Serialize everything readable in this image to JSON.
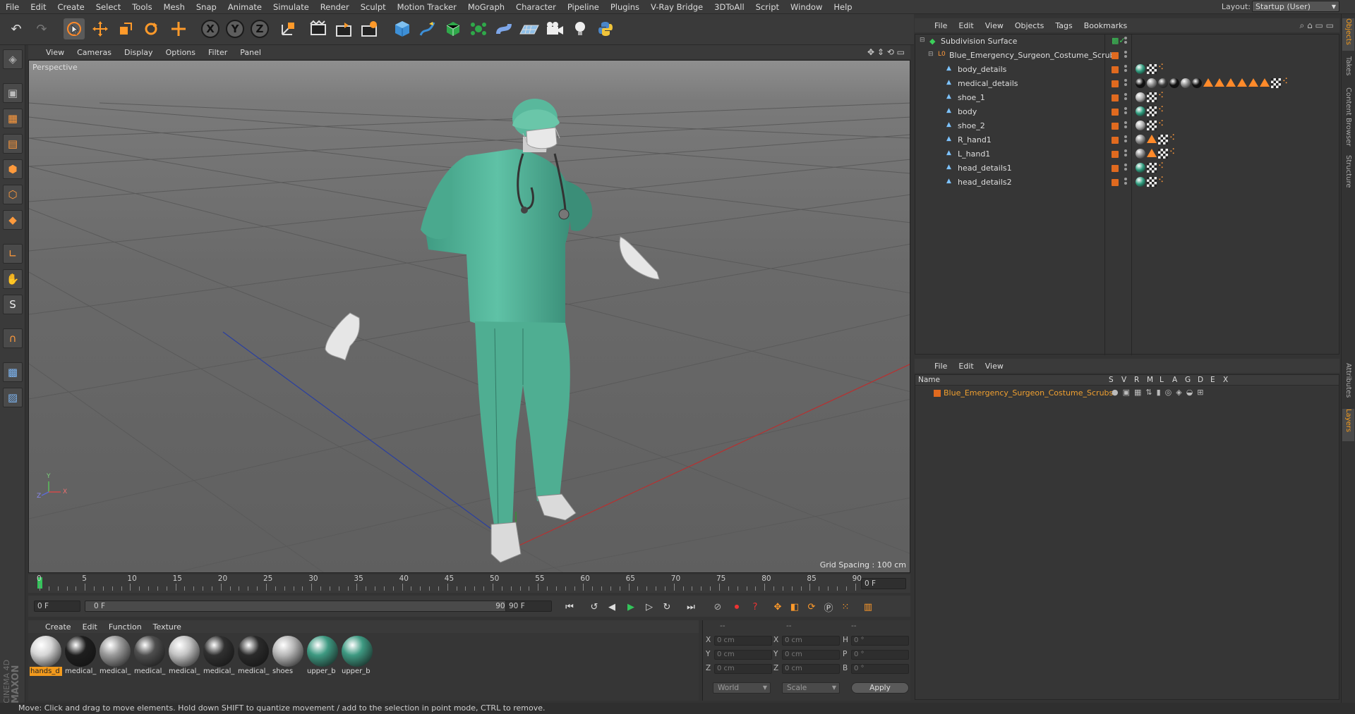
{
  "menubar": {
    "items": [
      "File",
      "Edit",
      "Create",
      "Select",
      "Tools",
      "Mesh",
      "Snap",
      "Animate",
      "Simulate",
      "Render",
      "Sculpt",
      "Motion Tracker",
      "MoGraph",
      "Character",
      "Pipeline",
      "Plugins",
      "V-Ray Bridge",
      "3DToAll",
      "Script",
      "Window",
      "Help"
    ],
    "layout_label": "Layout:",
    "layout_value": "Startup (User)"
  },
  "toolbar": {
    "icons": [
      "undo-icon",
      "redo-icon",
      "live-select-icon",
      "move-icon",
      "scale-icon",
      "rotate-icon",
      "recent-tool-icon",
      "x-axis-lock",
      "y-axis-lock",
      "z-axis-lock",
      "world-coordinates-icon",
      "render-view-icon",
      "render-picture-viewer-icon",
      "edit-render-settings-icon",
      "cube-primitive-icon",
      "pen-spline-icon",
      "subdivision-surface-icon",
      "cloner-icon",
      "deformer-icon",
      "floor-icon",
      "camera-icon",
      "light-icon",
      "python-icon"
    ],
    "axis_labels": [
      "X",
      "Y",
      "Z"
    ]
  },
  "leftbar": {
    "icons": [
      "make-editable-icon",
      "model-mode-icon",
      "texture-mode-icon",
      "workplane-mode-icon",
      "points-mode-icon",
      "edges-mode-icon",
      "polygons-mode-icon",
      "axis-mode-icon",
      "tweak-mode-icon",
      "solo-mode-icon",
      "snap-icon",
      "workplane-lock-icon",
      "workplane-snap-icon"
    ],
    "brand_line1": "MAXON",
    "brand_line2": "CINEMA 4D"
  },
  "viewport": {
    "menu": [
      "View",
      "Cameras",
      "Display",
      "Options",
      "Filter",
      "Panel"
    ],
    "camera_label": "Perspective",
    "grid_spacing": "Grid Spacing : 100 cm",
    "axis_labels": [
      "Y",
      "Z",
      "X"
    ]
  },
  "timeline": {
    "ticks": [
      "0",
      "5",
      "10",
      "15",
      "20",
      "25",
      "30",
      "35",
      "40",
      "45",
      "50",
      "55",
      "60",
      "65",
      "70",
      "75",
      "80",
      "85",
      "90"
    ],
    "current_frame": "0 F",
    "start_field": "0 F",
    "range_start": "0 F",
    "range_end": "90 F",
    "end_field": "90 F"
  },
  "materials": {
    "menu": [
      "Create",
      "Edit",
      "Function",
      "Texture"
    ],
    "items": [
      {
        "label": "hands_d",
        "color": "#d6d6d6",
        "selected": true
      },
      {
        "label": "medical_",
        "color": "#1e1e1e",
        "selected": false
      },
      {
        "label": "medical_",
        "color": "#9a9a9a",
        "selected": false
      },
      {
        "label": "medical_",
        "color": "#4e4e4e",
        "selected": false
      },
      {
        "label": "medical_",
        "color": "#c4c4c4",
        "selected": false
      },
      {
        "label": "medical_",
        "color": "#303030",
        "selected": false
      },
      {
        "label": "medical_",
        "color": "#2a2a2a",
        "selected": false
      },
      {
        "label": "shoes",
        "color": "#b8b8b8",
        "selected": false
      },
      {
        "label": "upper_b",
        "color": "#3e9a82",
        "selected": false
      },
      {
        "label": "upper_b",
        "color": "#3e9a82",
        "selected": false
      }
    ]
  },
  "coordinates": {
    "headers": [
      "--",
      "--",
      "--"
    ],
    "rows": [
      {
        "l1": "X",
        "v1": "0 cm",
        "l2": "X",
        "v2": "0 cm",
        "l3": "H",
        "v3": "0 °"
      },
      {
        "l1": "Y",
        "v1": "0 cm",
        "l2": "Y",
        "v2": "0 cm",
        "l3": "P",
        "v3": "0 °"
      },
      {
        "l1": "Z",
        "v1": "0 cm",
        "l2": "Z",
        "v2": "0 cm",
        "l3": "B",
        "v3": "0 °"
      }
    ],
    "mode": "World",
    "size_mode": "Scale",
    "apply": "Apply"
  },
  "status": "Move: Click and drag to move elements. Hold down SHIFT to quantize movement / add to the selection in point mode, CTRL to remove.",
  "objects": {
    "menu": [
      "File",
      "Edit",
      "View",
      "Objects",
      "Tags",
      "Bookmarks"
    ],
    "rows": [
      {
        "name": "Subdivision Surface",
        "indent": 0,
        "type": "generator"
      },
      {
        "name": "Blue_Emergency_Surgeon_Costume_Scrubs",
        "indent": 1,
        "type": "null"
      },
      {
        "name": "body_details",
        "indent": 2,
        "type": "mesh",
        "tags": [
          "green",
          "check",
          "uv"
        ]
      },
      {
        "name": "medical_details",
        "indent": 2,
        "type": "mesh",
        "tags": [
          "black",
          "grey",
          "dark",
          "black",
          "grey",
          "black",
          "tri",
          "tri",
          "tri",
          "tri",
          "tri",
          "tri",
          "check",
          "uv"
        ]
      },
      {
        "name": "shoe_1",
        "indent": 2,
        "type": "mesh",
        "tags": [
          "lightgrey",
          "check",
          "uv"
        ]
      },
      {
        "name": "body",
        "indent": 2,
        "type": "mesh",
        "tags": [
          "green",
          "check",
          "uv"
        ]
      },
      {
        "name": "shoe_2",
        "indent": 2,
        "type": "mesh",
        "tags": [
          "lightgrey",
          "check",
          "uv"
        ]
      },
      {
        "name": "R_hand1",
        "indent": 2,
        "type": "mesh",
        "tags": [
          "grey",
          "tri",
          "check",
          "uv"
        ]
      },
      {
        "name": "L_hand1",
        "indent": 2,
        "type": "mesh",
        "tags": [
          "grey",
          "tri",
          "check",
          "uv"
        ]
      },
      {
        "name": "head_details1",
        "indent": 2,
        "type": "mesh",
        "tags": [
          "green",
          "check",
          "uv"
        ]
      },
      {
        "name": "head_details2",
        "indent": 2,
        "type": "mesh",
        "tags": [
          "green",
          "check",
          "uv"
        ]
      }
    ]
  },
  "layers": {
    "menu": [
      "File",
      "Edit",
      "View"
    ],
    "columns": [
      "Name",
      "S",
      "V",
      "R",
      "M",
      "L",
      "A",
      "G",
      "D",
      "E",
      "X"
    ],
    "rows": [
      {
        "name": "Blue_Emergency_Surgeon_Costume_Scrubs",
        "color": "#e06a1f"
      }
    ]
  },
  "right_tabs": [
    "Objects",
    "Takes",
    "Content Browser",
    "Structure",
    "Attributes",
    "Layers"
  ],
  "colors": {
    "accent": "#f29a1d",
    "scrubs": "#4fb59a",
    "layer_text": "#f0a030"
  }
}
